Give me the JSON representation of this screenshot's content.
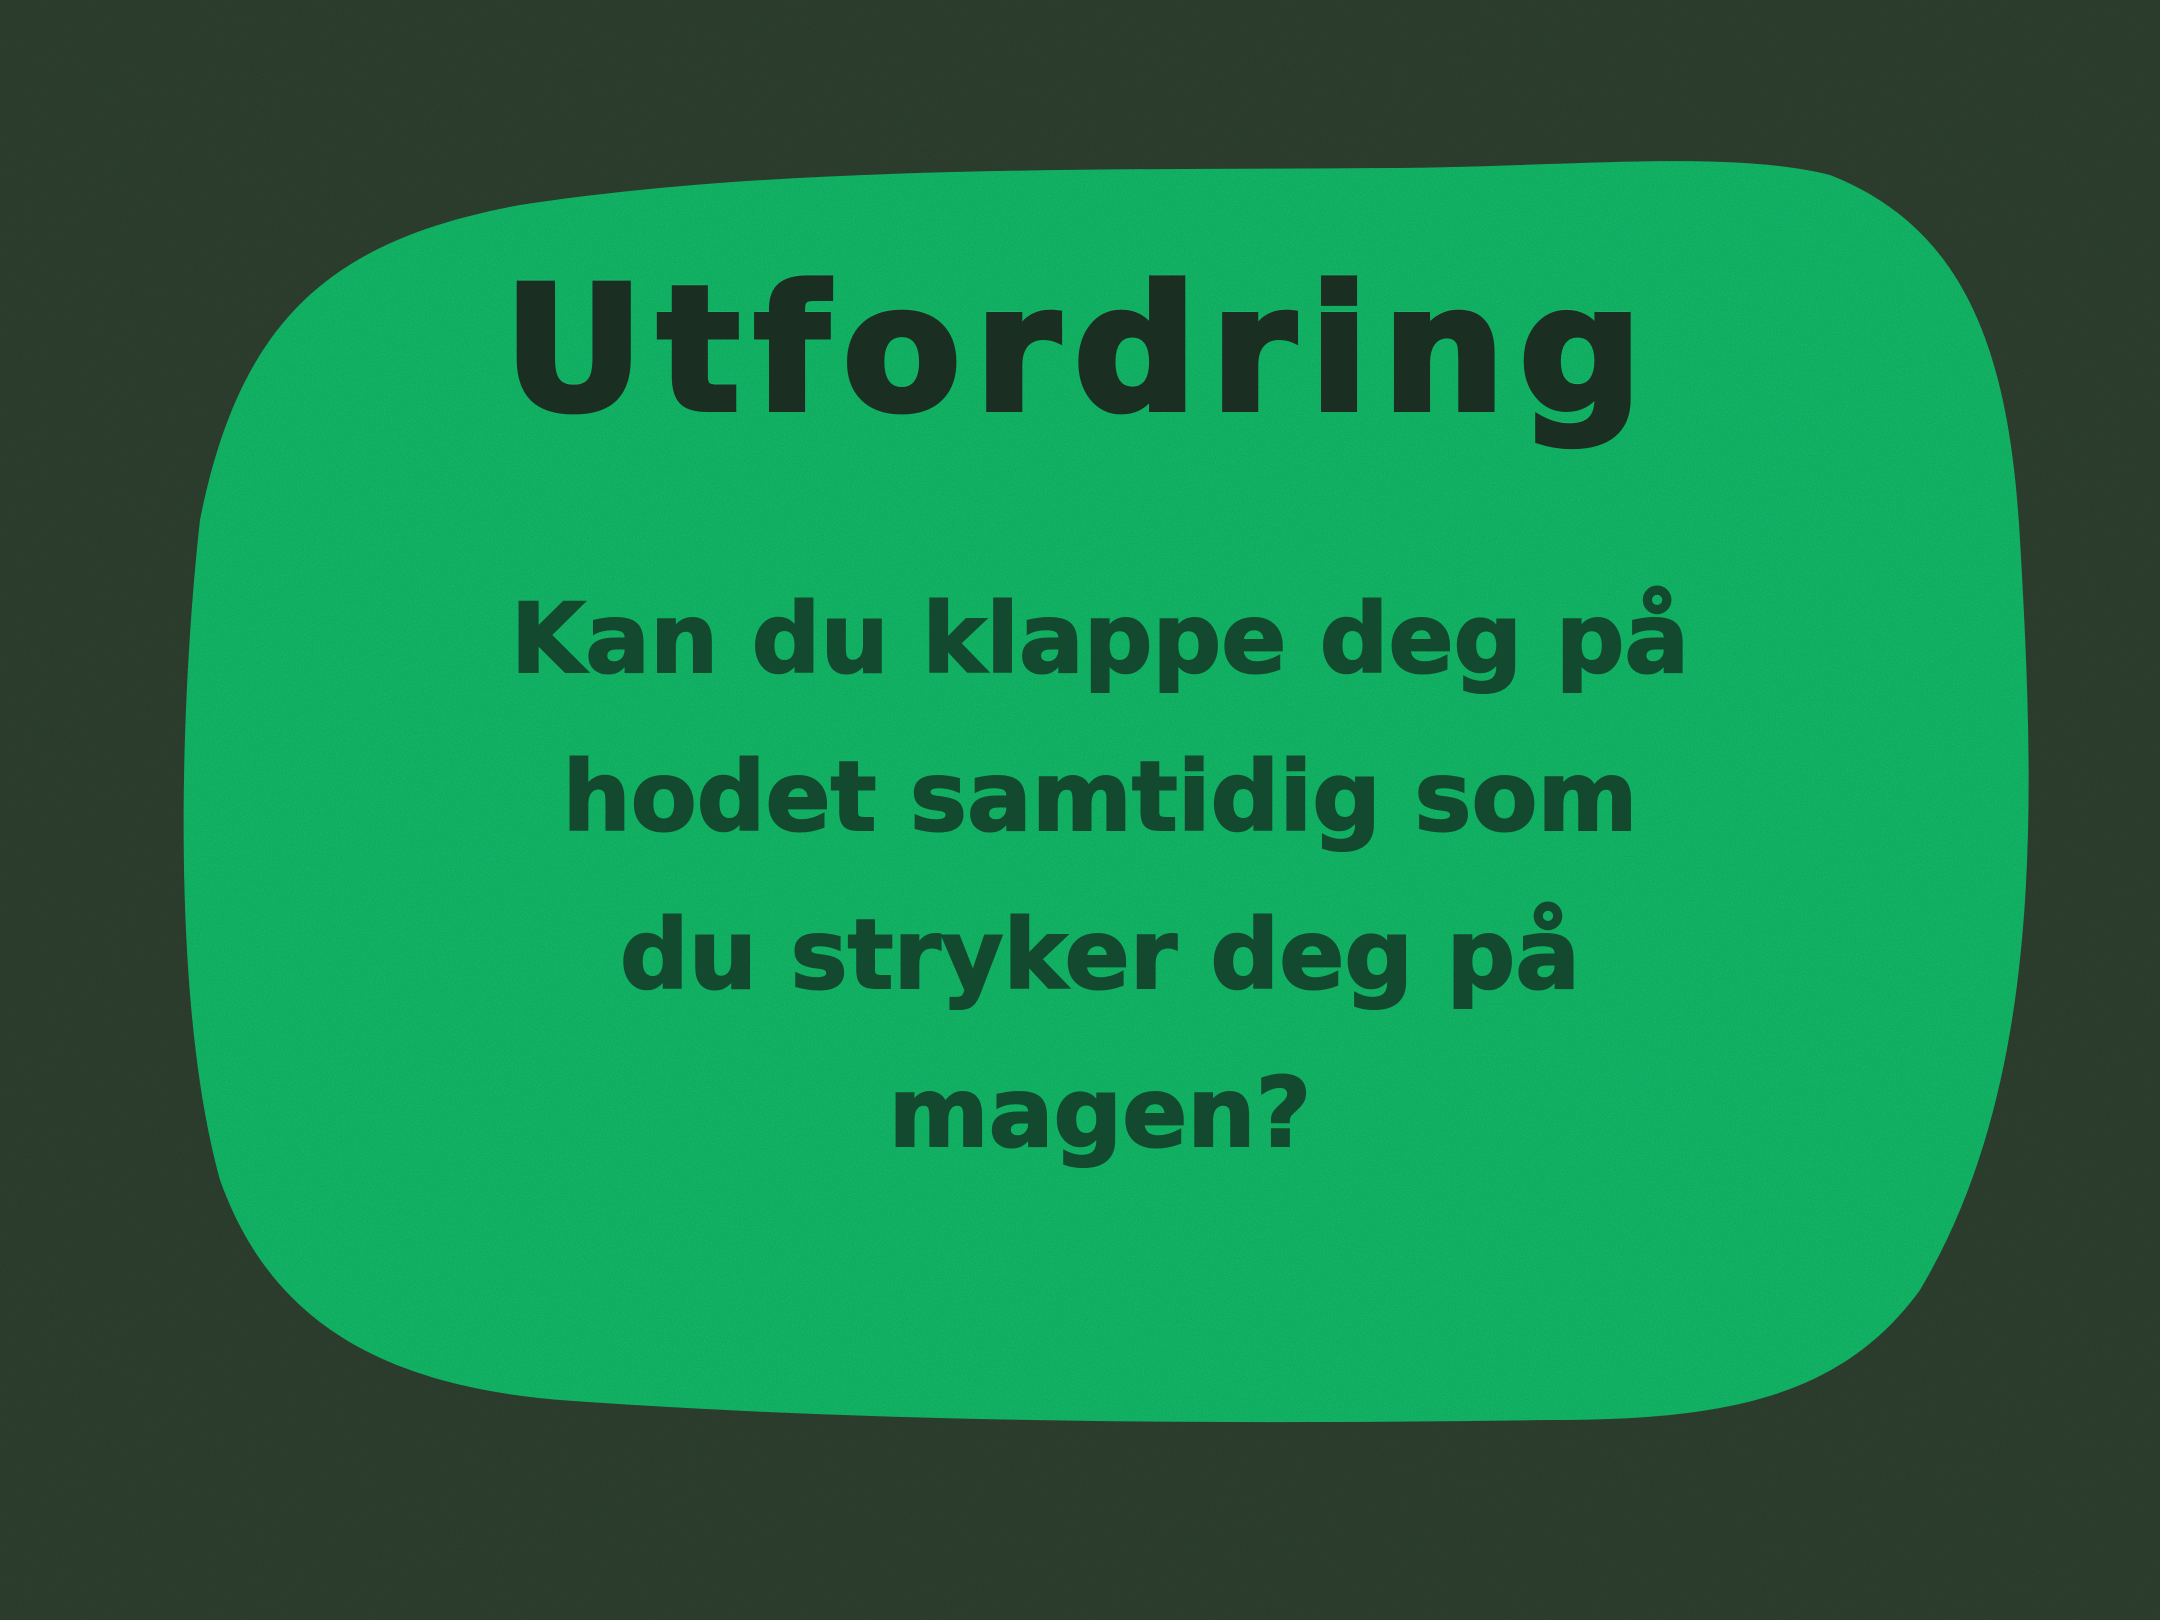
{
  "card": {
    "title": "Utfordring",
    "question_lines": [
      "Kan du klappe deg på",
      "hodet samtidig som",
      "du stryker deg på",
      "magen?"
    ]
  },
  "colors": {
    "background": "#2f4231",
    "card": "#13c06c",
    "title_text": "#1a2f22",
    "body_text": "#134a2f"
  }
}
